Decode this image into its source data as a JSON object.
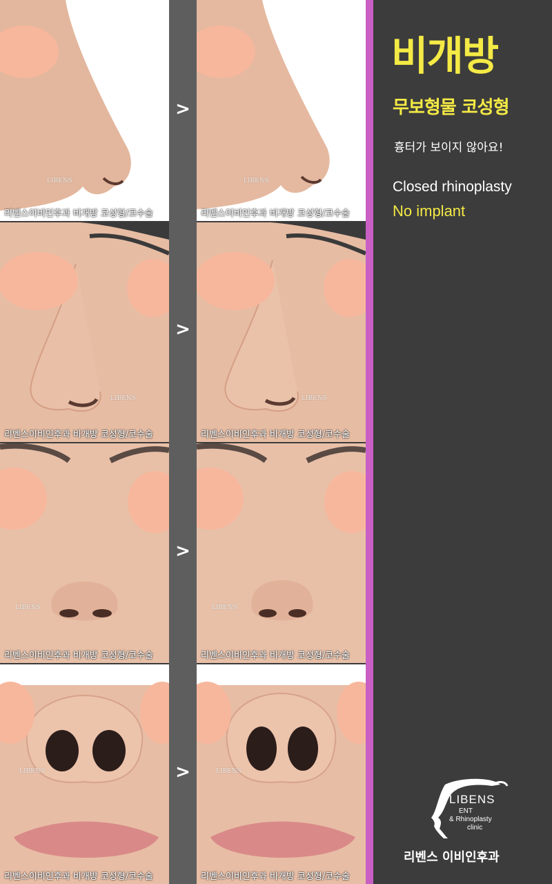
{
  "panel": {
    "title": "비개방",
    "subtitle": "무보형물 코성형",
    "note": "흉터가 보이지 않아요!",
    "english_line1": "Closed rhinoplasty",
    "english_line2": "No implant",
    "logo_name": "LIBENS",
    "logo_line1": "ENT",
    "logo_line2": "& Rhinoplasty",
    "logo_line3": "clinic",
    "clinic_name": "리벤스 이비인후과"
  },
  "photos": {
    "watermark": "리벤스이비인후과  비개방 코성형/코수술",
    "brand_mark": "LIBENS",
    "arrow": ">",
    "rows": [
      {
        "view": "side profile"
      },
      {
        "view": "three-quarter"
      },
      {
        "view": "front"
      },
      {
        "view": "base"
      }
    ]
  },
  "colors": {
    "accent_yellow": "#f4ea45",
    "accent_purple": "#c95fc4",
    "panel_background": "#3c3c3c",
    "divider": "#5e5e5e",
    "face_mask": "#f7b79d"
  }
}
